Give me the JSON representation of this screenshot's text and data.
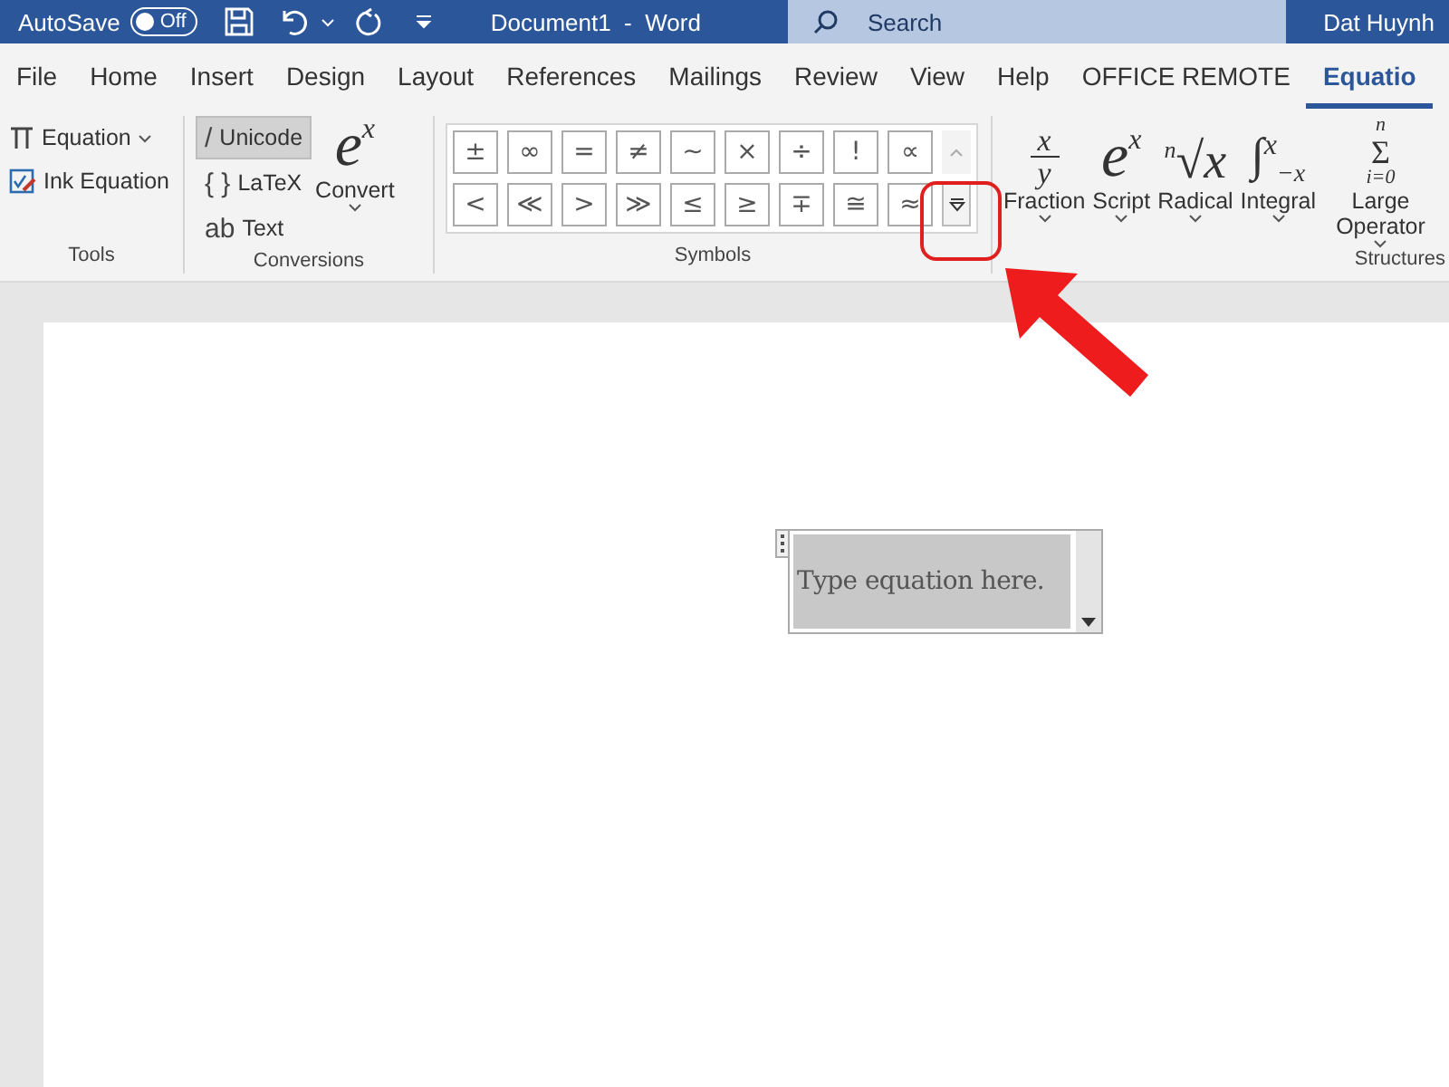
{
  "title_bar": {
    "autosave_label": "AutoSave",
    "autosave_toggle": {
      "label": "Off",
      "on": false
    },
    "document_title": "Document1  -  Word",
    "search": {
      "placeholder": "Search"
    },
    "user": "Dat Huynh"
  },
  "tabs": [
    {
      "label": "File",
      "selected": false
    },
    {
      "label": "Home",
      "selected": false
    },
    {
      "label": "Insert",
      "selected": false
    },
    {
      "label": "Design",
      "selected": false
    },
    {
      "label": "Layout",
      "selected": false
    },
    {
      "label": "References",
      "selected": false
    },
    {
      "label": "Mailings",
      "selected": false
    },
    {
      "label": "Review",
      "selected": false
    },
    {
      "label": "View",
      "selected": false
    },
    {
      "label": "Help",
      "selected": false
    },
    {
      "label": "OFFICE REMOTE",
      "selected": false
    },
    {
      "label": "Equatio",
      "selected": true
    }
  ],
  "ribbon": {
    "tools": {
      "label": "Tools",
      "equation": "Equation",
      "ink_equation": "Ink Equation"
    },
    "conversions": {
      "label": "Conversions",
      "options": [
        {
          "glyph": "/",
          "label": "Unicode",
          "selected": true
        },
        {
          "glyph": "{ }",
          "label": "LaTeX",
          "selected": false
        }
      ],
      "text_option": {
        "glyph": "ab",
        "label": "Text"
      },
      "convert": {
        "base": "e",
        "sup": "x",
        "label": "Convert"
      }
    },
    "symbols": {
      "label": "Symbols",
      "rows": [
        [
          "±",
          "∞",
          "=",
          "≠",
          "~",
          "×",
          "÷",
          "!",
          "∝"
        ],
        [
          "<",
          "≪",
          ">",
          "≫",
          "≤",
          "≥",
          "∓",
          "≅",
          "≈"
        ]
      ]
    },
    "structures": {
      "label": "Structures",
      "items": [
        {
          "kind": "fraction",
          "top": "x",
          "bottom": "y",
          "label": "Fraction"
        },
        {
          "kind": "script",
          "base": "e",
          "sup": "x",
          "label": "Script"
        },
        {
          "kind": "radical",
          "index": "n",
          "base": "√x",
          "label": "Radical"
        },
        {
          "kind": "integral",
          "base": "∫",
          "sup": "x",
          "sub": "−x",
          "label": "Integral"
        },
        {
          "kind": "operator",
          "top": "n",
          "base": "Σ",
          "bottom": "i=0",
          "label": "Large Operator"
        }
      ]
    }
  },
  "document": {
    "equation_placeholder": "Type equation here."
  }
}
